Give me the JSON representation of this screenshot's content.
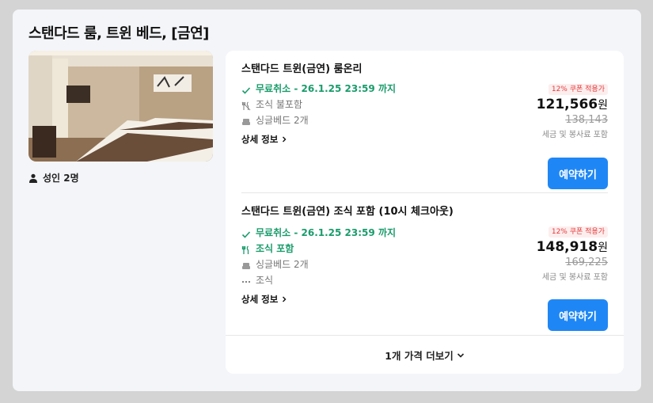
{
  "room": {
    "title": "스탠다드 룸, 트윈 베드, [금연]",
    "occupancy": "성인 2명"
  },
  "rates": [
    {
      "name": "스탠다드 트윈(금연) 룸온리",
      "cancellation": "무료취소 - 26.1.25 23:59 까지",
      "meal": "조식 불포함",
      "bed": "싱글베드 2개",
      "detail": "상세 정보",
      "coupon": "12% 쿠폰 적용가",
      "price": "121,566",
      "currency": "원",
      "original_price": "138,143",
      "tax_note": "세금 및 봉사료 포함",
      "book": "예약하기"
    },
    {
      "name": "스탠다드 트윈(금연) 조식 포함 (10시 체크아웃)",
      "cancellation": "무료취소 - 26.1.25 23:59 까지",
      "meal": "조식 포함",
      "bed": "싱글베드 2개",
      "extra": "조식",
      "detail": "상세 정보",
      "coupon": "12% 쿠폰 적용가",
      "price": "148,918",
      "currency": "원",
      "original_price": "169,225",
      "tax_note": "세금 및 봉사료 포함",
      "book": "예약하기"
    }
  ],
  "more_prices": "1개 가격 더보기",
  "colors": {
    "accent": "#1f87f5",
    "green": "#1a9c6c",
    "coupon_red": "#e53b3b"
  }
}
